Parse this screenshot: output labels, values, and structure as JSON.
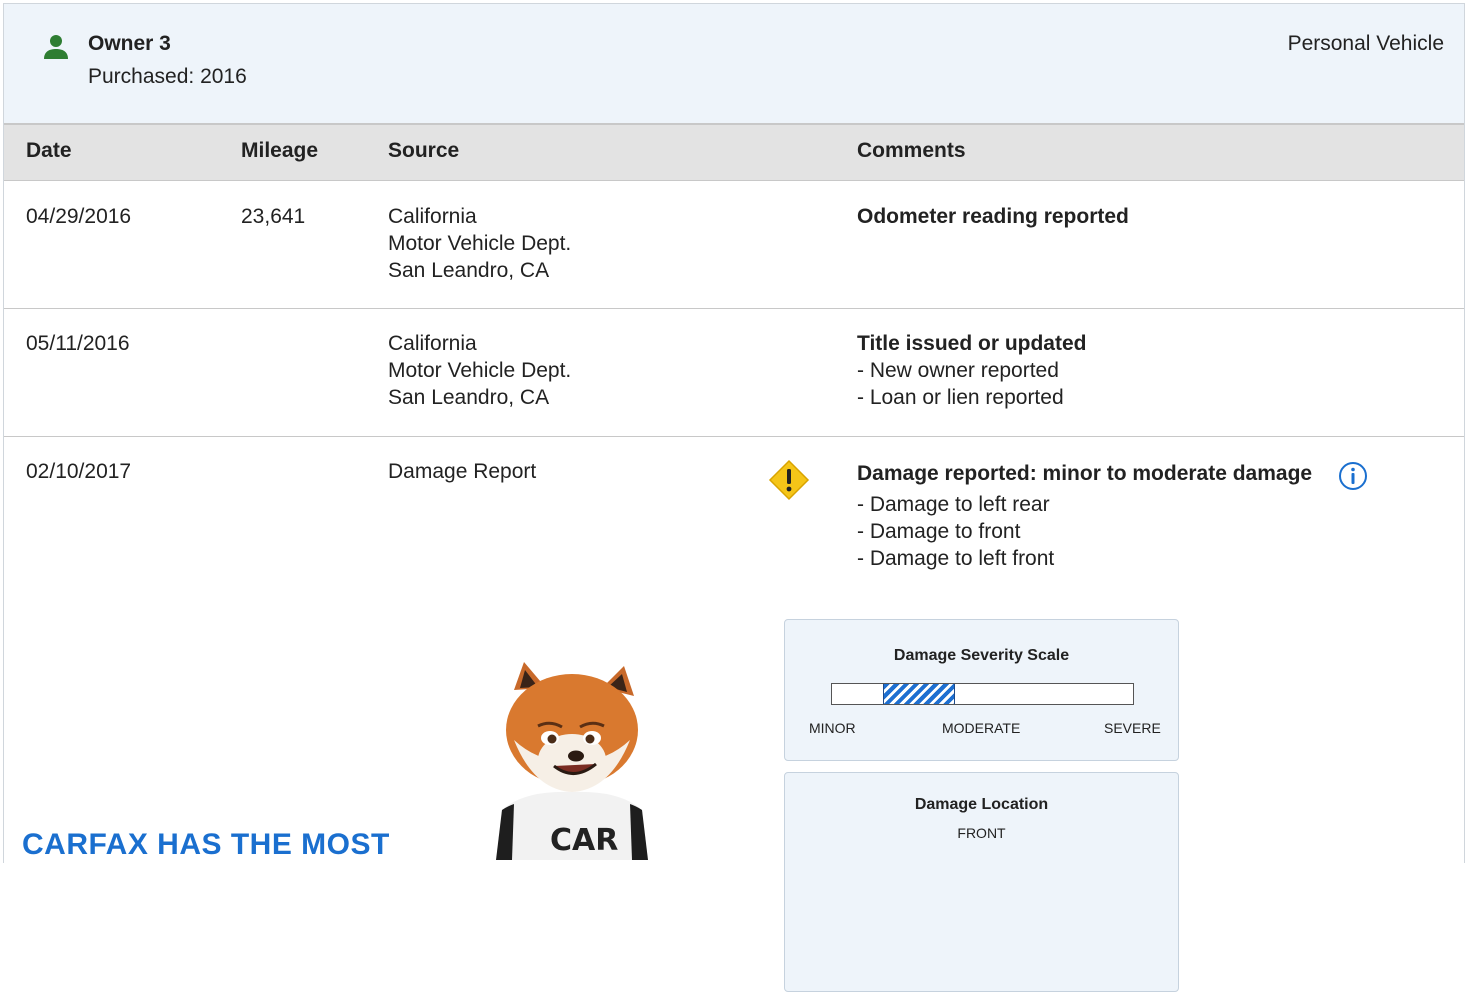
{
  "owner": {
    "icon": "person-icon",
    "name": "Owner 3",
    "purchased": "Purchased: 2016",
    "vehicle_type": "Personal Vehicle",
    "icon_color": "#2e7d32"
  },
  "table": {
    "headers": [
      "Date",
      "Mileage",
      "Source",
      "Comments"
    ],
    "rows": [
      {
        "date": "04/29/2016",
        "mileage": "23,641",
        "source": [
          "California",
          "Motor Vehicle Dept.",
          "San Leandro, CA"
        ],
        "comment_title": "Odometer reading reported",
        "comment_items": []
      },
      {
        "date": "05/11/2016",
        "mileage": "",
        "source": [
          "California",
          "Motor Vehicle Dept.",
          "San Leandro, CA"
        ],
        "comment_title": "Title issued or updated",
        "comment_items": [
          "- New owner reported",
          "- Loan or lien reported"
        ]
      },
      {
        "date": "02/10/2017",
        "mileage": "",
        "source": [
          "Damage Report"
        ],
        "comment_title": "Damage reported: minor to moderate damage",
        "comment_items": [
          "- Damage to left rear",
          "- Damage to front",
          "- Damage to left front"
        ],
        "icons": [
          "warning-icon",
          "info-icon"
        ]
      }
    ]
  },
  "severity": {
    "title": "Damage Severity Scale",
    "labels": [
      "MINOR",
      "MODERATE",
      "SEVERE"
    ],
    "range_start": 0.17,
    "range_end": 0.41,
    "fill_color": "#1d6fd1"
  },
  "location": {
    "title": "Damage Location",
    "front_label": "FRONT"
  },
  "promo": {
    "title": "CARFAX HAS THE MOST",
    "title_color": "#1a6fcf",
    "mascot": "fox-mascot",
    "shirt_text": "CAR"
  },
  "colors": {
    "warning": "#f5c518",
    "info": "#1a6fcf",
    "header_bg": "#eef4fa",
    "table_head_bg": "#e3e3e3"
  }
}
